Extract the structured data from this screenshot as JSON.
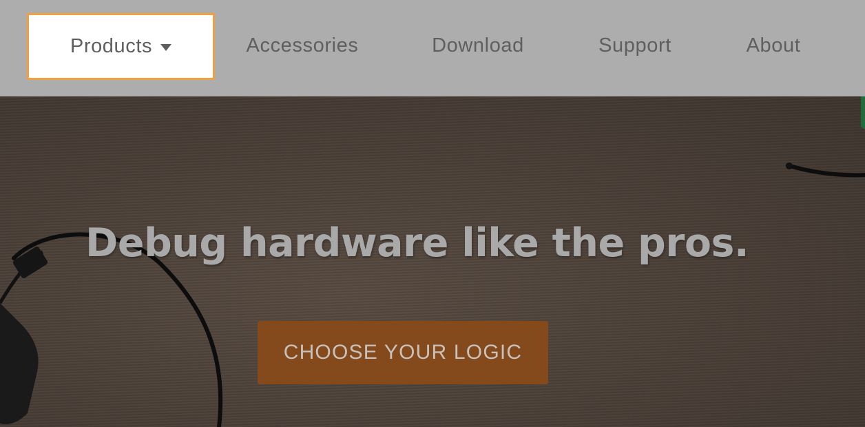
{
  "nav": {
    "items": [
      {
        "label": "Products",
        "active": true,
        "has_dropdown": true
      },
      {
        "label": "Accessories"
      },
      {
        "label": "Download"
      },
      {
        "label": "Support"
      },
      {
        "label": "About"
      }
    ]
  },
  "hero": {
    "headline": "Debug hardware like the pros.",
    "cta_label": "CHOOSE YOUR LOGIC"
  },
  "colors": {
    "nav_background": "#adadad",
    "active_outline": "#f0a040",
    "cta_background": "#854a1c",
    "hero_background": "#4a4038"
  }
}
